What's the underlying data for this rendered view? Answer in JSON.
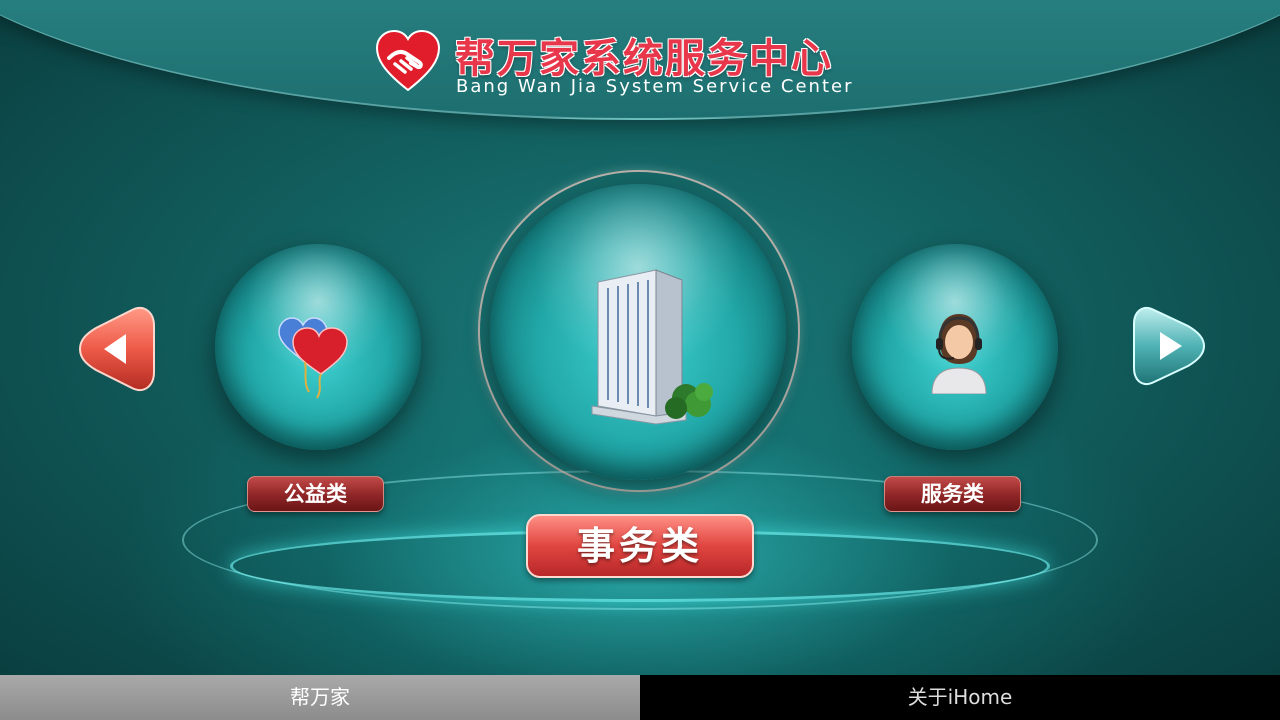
{
  "header": {
    "title": "帮万家系统服务中心",
    "subtitle": "Bang Wan Jia System Service Center",
    "logo_icon": "heart-handshake-icon"
  },
  "carousel": {
    "prev_icon": "arrow-left-icon",
    "next_icon": "arrow-right-icon",
    "items": [
      {
        "label": "公益类",
        "icon": "heart-balloons-icon"
      },
      {
        "label": "事务类",
        "icon": "office-building-icon"
      },
      {
        "label": "服务类",
        "icon": "customer-service-agent-icon"
      }
    ],
    "selected_index": 1
  },
  "tabs": [
    {
      "label": "帮万家",
      "active": true
    },
    {
      "label": "关于iHome",
      "active": false
    }
  ],
  "colors": {
    "accent_red": "#e04540",
    "teal": "#1b7a7a",
    "tab_active": "#8c8c8c",
    "tab_inactive": "#000000"
  }
}
